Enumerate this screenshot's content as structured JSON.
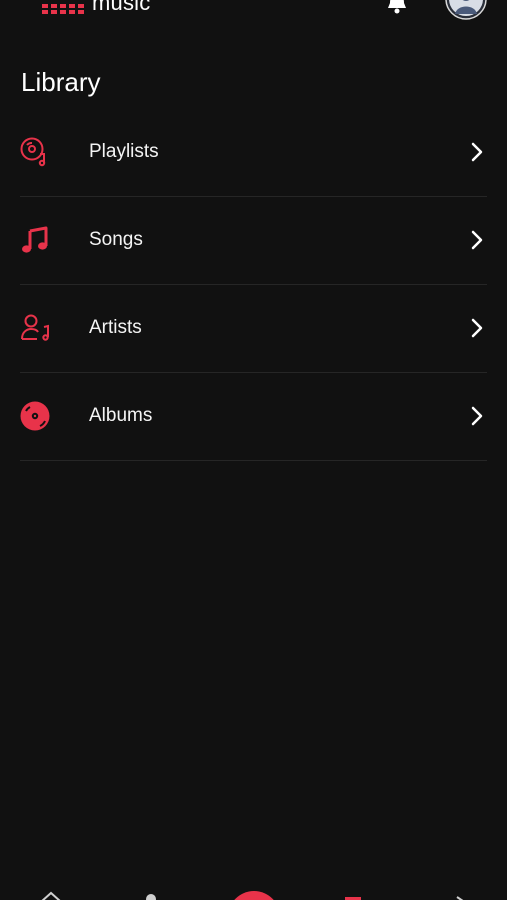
{
  "app": {
    "logo_text": "music",
    "accent_color": "#e8334a",
    "background_color": "#111111"
  },
  "header": {
    "notification_icon": "bell-icon",
    "avatar_icon": "user-avatar-icon"
  },
  "page": {
    "title": "Library"
  },
  "library": {
    "items": [
      {
        "label": "Playlists",
        "icon": "vinyl-playlist-icon"
      },
      {
        "label": "Songs",
        "icon": "music-note-icon"
      },
      {
        "label": "Artists",
        "icon": "artist-icon"
      },
      {
        "label": "Albums",
        "icon": "album-disc-icon"
      }
    ]
  },
  "bottom_nav": {
    "items": [
      {
        "icon": "home-icon"
      },
      {
        "icon": "search-icon"
      },
      {
        "icon": "play-center-icon"
      },
      {
        "icon": "library-icon"
      },
      {
        "icon": "more-icon"
      }
    ]
  }
}
